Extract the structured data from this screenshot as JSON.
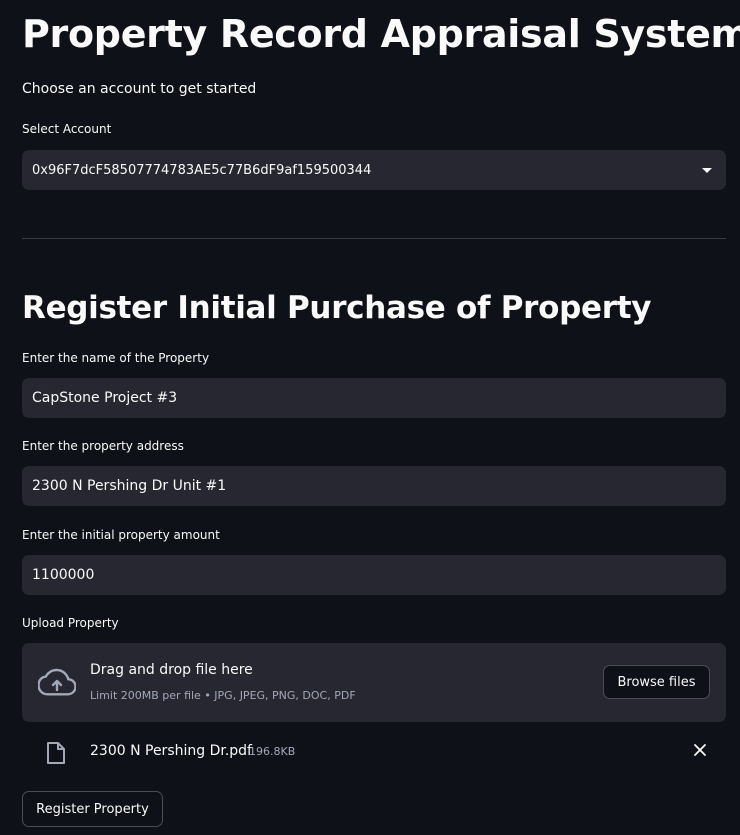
{
  "header": {
    "title": "Property Record Appraisal System",
    "subtitle": "Choose an account to get started"
  },
  "account": {
    "label": "Select Account",
    "selected": "0x96F7dcF58507774783AE5c77B6dF9af159500344"
  },
  "register": {
    "heading": "Register Initial Purchase of Property",
    "name_label": "Enter the name of the Property",
    "name_value": "CapStone Project #3",
    "address_label": "Enter the property address",
    "address_value": "2300 N Pershing Dr Unit #1",
    "amount_label": "Enter the initial property amount",
    "amount_value": "1100000",
    "submit_label": "Register Property"
  },
  "upload": {
    "label": "Upload Property",
    "drop_title": "Drag and drop file here",
    "drop_hint": "Limit 200MB per file • JPG, JPEG, PNG, DOC, PDF",
    "browse_label": "Browse files",
    "file": {
      "name": "2300 N Pershing Dr.pdf",
      "size": "196.8KB"
    }
  },
  "icons": {
    "upload": "cloud-upload-icon",
    "file": "file-icon",
    "close": "close-icon",
    "dropdown": "chevron-down-icon"
  },
  "colors": {
    "background": "#0e1117",
    "field": "#262730",
    "text": "#fafafa",
    "muted": "#a3a8b8"
  }
}
